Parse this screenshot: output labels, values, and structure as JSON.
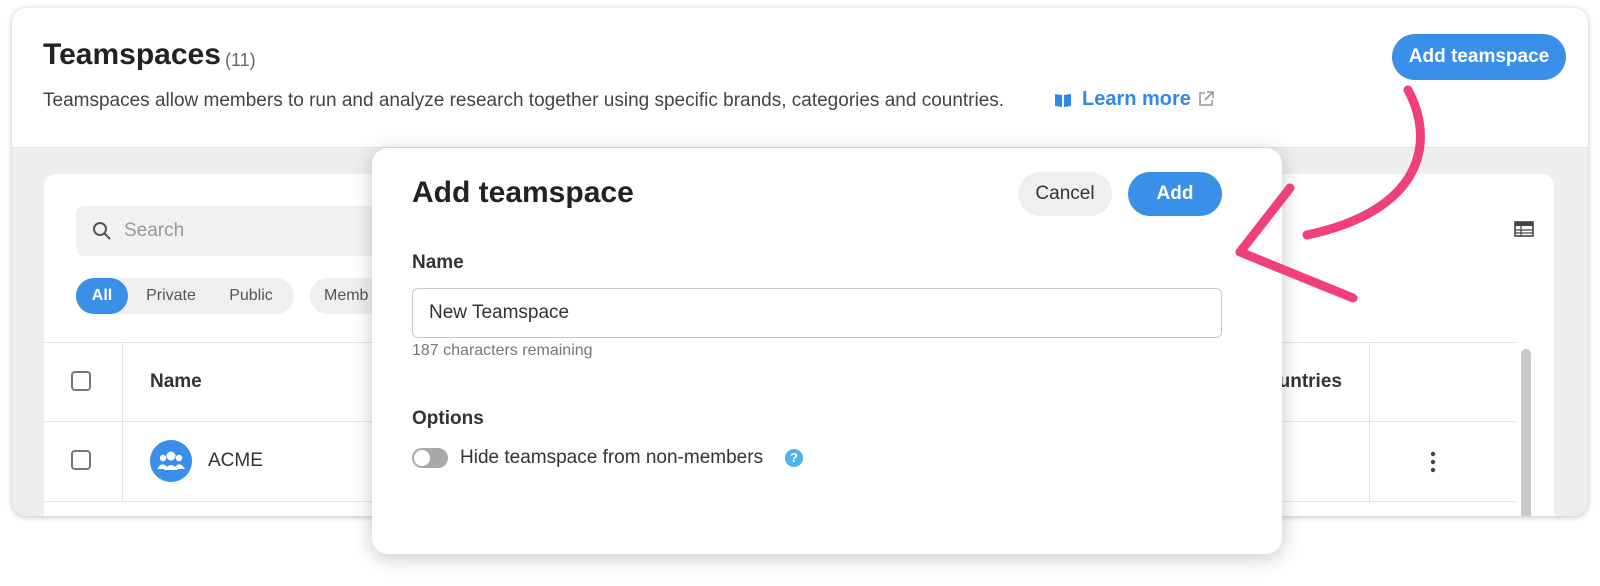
{
  "header": {
    "title": "Teamspaces",
    "count": "(11)",
    "description": "Teamspaces allow members to run and analyze research together using specific brands, categories and countries.",
    "learn_more": "Learn more",
    "add_button": "Add teamspace"
  },
  "toolbar": {
    "search_placeholder": "Search",
    "filters": [
      "All",
      "Private",
      "Public"
    ],
    "member_filter": "Memb"
  },
  "table": {
    "columns": {
      "name": "Name",
      "countries": "ountries"
    },
    "rows": [
      {
        "name": "ACME"
      }
    ]
  },
  "modal": {
    "title": "Add teamspace",
    "cancel": "Cancel",
    "add": "Add",
    "name_label": "Name",
    "name_value": "New Teamspace",
    "remaining": "187 characters remaining",
    "options_label": "Options",
    "toggle_label": "Hide teamspace from non-members",
    "toggle_on": false,
    "help_glyph": "?"
  },
  "colors": {
    "accent": "#3a8fe8",
    "arrow": "#f0407a",
    "help": "#4fb3e6"
  },
  "icons": [
    "search-icon",
    "book-icon",
    "external-link-icon",
    "table-view-icon",
    "team-avatar-icon",
    "kebab-menu-icon",
    "help-icon",
    "arrow-annotation"
  ]
}
